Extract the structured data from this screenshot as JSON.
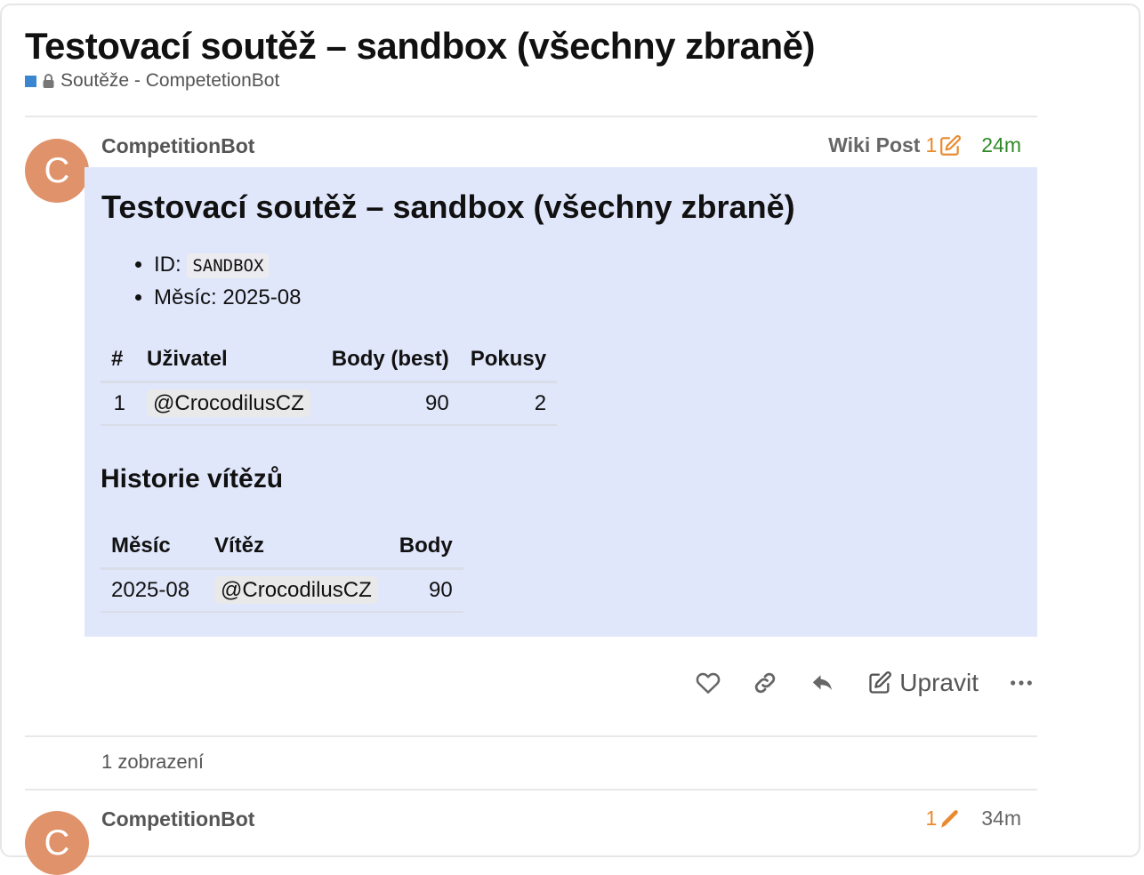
{
  "topic": {
    "title": "Testovací soutěž – sandbox (všechny zbraně)",
    "category": "Soutěže - CompetetionBot",
    "category_color": "#3a86d1"
  },
  "post1": {
    "avatar_letter": "C",
    "avatar_color": "#e0926a",
    "username": "CompetitionBot",
    "wiki_label": "Wiki Post",
    "edit_count": "1",
    "age": "24m",
    "content": {
      "heading": "Testovací soutěž – sandbox (všechny zbraně)",
      "id_label": "ID:",
      "id_value": "SANDBOX",
      "month_label": "Měsíc: 2025-08",
      "standings": {
        "headers": [
          "#",
          "Uživatel",
          "Body (best)",
          "Pokusy"
        ],
        "rows": [
          [
            "1",
            "@CrocodilusCZ",
            "90",
            "2"
          ]
        ]
      },
      "history_heading": "Historie vítězů",
      "history": {
        "headers": [
          "Měsíc",
          "Vítěz",
          "Body"
        ],
        "rows": [
          [
            "2025-08",
            "@CrocodilusCZ",
            "90"
          ]
        ]
      }
    },
    "actions": {
      "edit_label": "Upravit"
    },
    "views": "1 zobrazení"
  },
  "post2": {
    "avatar_letter": "C",
    "username": "CompetitionBot",
    "edit_count": "1",
    "age": "34m"
  }
}
